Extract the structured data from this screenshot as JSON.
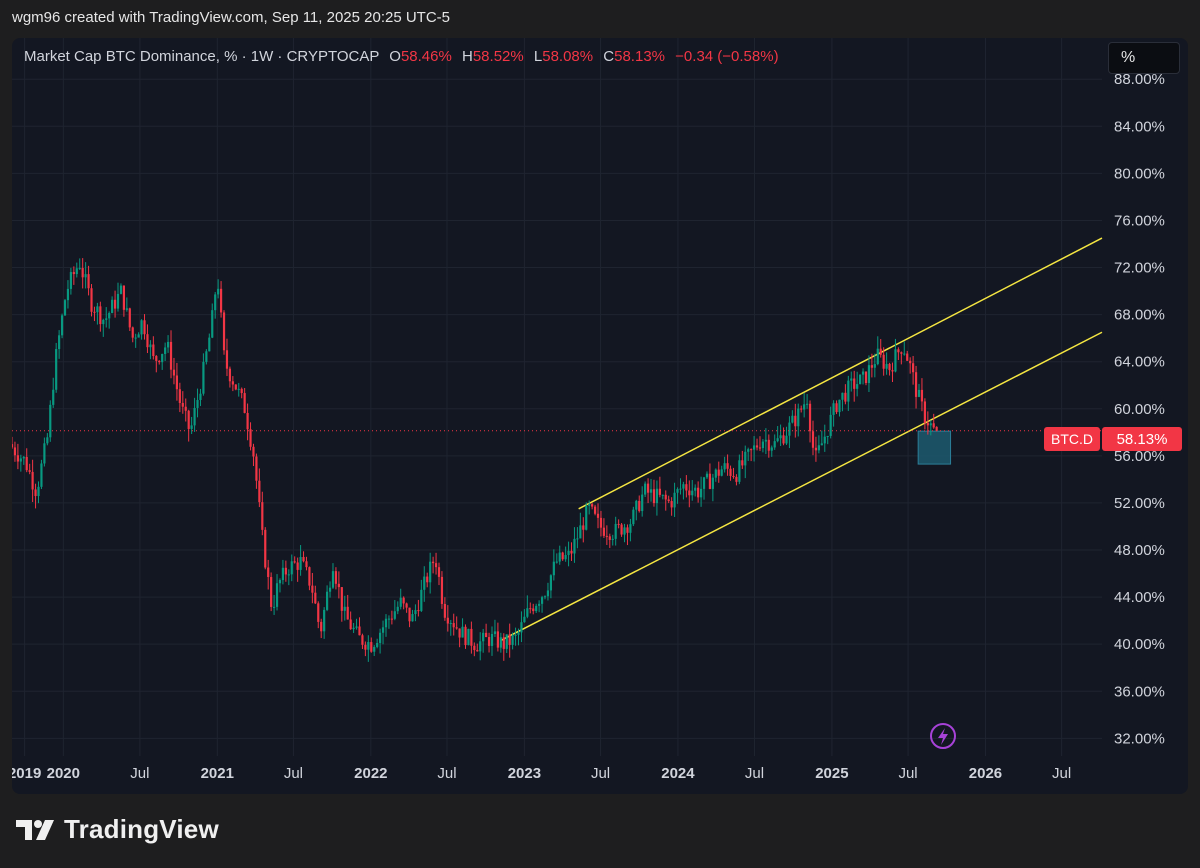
{
  "header": {
    "credit": "wgm96 created with TradingView.com, Sep 11, 2025 20:25 UTC-5"
  },
  "legend": {
    "symbol": "Market Cap BTC Dominance, % · 1W · CRYPTOCAP",
    "o_label": "O",
    "o_value": "58.46%",
    "h_label": "H",
    "h_value": "58.52%",
    "l_label": "L",
    "l_value": "58.08%",
    "c_label": "C",
    "c_value": "58.13%",
    "change": "−0.34 (−0.58%)"
  },
  "scale_button": {
    "label": "%"
  },
  "price_tag": {
    "symbol": "BTC.D",
    "value": "58.13%"
  },
  "footer": {
    "brand": "TradingView"
  },
  "colors": {
    "background": "#131722",
    "up": "#089981",
    "down": "#f23645",
    "channel": "#f5e642",
    "box": "#1d5a6e",
    "grid": "#1f2430"
  },
  "icons": {
    "flash": "lightning-bolt-icon",
    "logo": "tradingview-logo-icon"
  },
  "chart_data": {
    "type": "candlestick",
    "title": "Market Cap BTC Dominance, % · 1W · CRYPTOCAP",
    "y_unit": "%",
    "ylim": [
      30.5,
      91.5
    ],
    "xlim": [
      "2019-09-01",
      "2026-10-05"
    ],
    "y_ticks": [
      "88.00%",
      "84.00%",
      "80.00%",
      "76.00%",
      "72.00%",
      "68.00%",
      "64.00%",
      "60.00%",
      "56.00%",
      "52.00%",
      "48.00%",
      "44.00%",
      "40.00%",
      "36.00%",
      "32.00%"
    ],
    "x_ticks": [
      {
        "label": "2019",
        "date": "2019-10-01",
        "bold": true
      },
      {
        "label": "2020",
        "date": "2020-01-01",
        "bold": true
      },
      {
        "label": "Jul",
        "date": "2020-07-01",
        "bold": false
      },
      {
        "label": "2021",
        "date": "2021-01-01",
        "bold": true
      },
      {
        "label": "Jul",
        "date": "2021-07-01",
        "bold": false
      },
      {
        "label": "2022",
        "date": "2022-01-01",
        "bold": true
      },
      {
        "label": "Jul",
        "date": "2022-07-01",
        "bold": false
      },
      {
        "label": "2023",
        "date": "2023-01-01",
        "bold": true
      },
      {
        "label": "Jul",
        "date": "2023-07-01",
        "bold": false
      },
      {
        "label": "2024",
        "date": "2024-01-01",
        "bold": true
      },
      {
        "label": "Jul",
        "date": "2024-07-01",
        "bold": false
      },
      {
        "label": "2025",
        "date": "2025-01-01",
        "bold": true
      },
      {
        "label": "Jul",
        "date": "2025-07-01",
        "bold": false
      },
      {
        "label": "2026",
        "date": "2026-01-01",
        "bold": true
      },
      {
        "label": "Jul",
        "date": "2026-07-01",
        "bold": false
      }
    ],
    "price_path": [
      [
        "2019-09-01",
        57.0
      ],
      [
        "2019-10-10",
        55.5
      ],
      [
        "2019-11-05",
        53.0
      ],
      [
        "2019-12-01",
        57.5
      ],
      [
        "2019-12-20",
        64.0
      ],
      [
        "2020-01-15",
        70.0
      ],
      [
        "2020-02-15",
        72.5
      ],
      [
        "2020-03-15",
        69.0
      ],
      [
        "2020-04-15",
        67.5
      ],
      [
        "2020-05-25",
        70.0
      ],
      [
        "2020-06-20",
        66.0
      ],
      [
        "2020-07-15",
        67.5
      ],
      [
        "2020-08-10",
        64.0
      ],
      [
        "2020-09-10",
        65.5
      ],
      [
        "2020-10-15",
        60.0
      ],
      [
        "2020-11-05",
        58.0
      ],
      [
        "2020-12-05",
        63.0
      ],
      [
        "2020-12-25",
        67.0
      ],
      [
        "2021-01-08",
        71.5
      ],
      [
        "2021-01-25",
        64.0
      ],
      [
        "2021-02-20",
        62.0
      ],
      [
        "2021-03-15",
        60.0
      ],
      [
        "2021-04-05",
        56.0
      ],
      [
        "2021-04-25",
        49.0
      ],
      [
        "2021-05-18",
        43.0
      ],
      [
        "2021-06-01",
        45.0
      ],
      [
        "2021-06-25",
        46.5
      ],
      [
        "2021-07-25",
        47.0
      ],
      [
        "2021-08-20",
        45.0
      ],
      [
        "2021-09-10",
        41.0
      ],
      [
        "2021-10-10",
        47.0
      ],
      [
        "2021-11-05",
        42.5
      ],
      [
        "2021-12-10",
        40.5
      ],
      [
        "2022-01-10",
        40.0
      ],
      [
        "2022-02-15",
        42.0
      ],
      [
        "2022-03-20",
        43.5
      ],
      [
        "2022-04-15",
        42.0
      ],
      [
        "2022-05-20",
        45.5
      ],
      [
        "2022-06-10",
        47.5
      ],
      [
        "2022-07-01",
        43.0
      ],
      [
        "2022-08-10",
        41.0
      ],
      [
        "2022-09-15",
        40.0
      ],
      [
        "2022-10-20",
        40.5
      ],
      [
        "2022-11-20",
        40.0
      ],
      [
        "2022-12-20",
        40.5
      ],
      [
        "2023-01-20",
        43.0
      ],
      [
        "2023-02-25",
        44.5
      ],
      [
        "2023-03-25",
        47.0
      ],
      [
        "2023-04-25",
        47.5
      ],
      [
        "2023-06-10",
        51.5
      ],
      [
        "2023-07-05",
        50.0
      ],
      [
        "2023-08-10",
        49.5
      ],
      [
        "2023-09-20",
        50.5
      ],
      [
        "2023-10-20",
        53.0
      ],
      [
        "2023-11-20",
        52.5
      ],
      [
        "2023-12-20",
        52.0
      ],
      [
        "2024-01-20",
        53.5
      ],
      [
        "2024-02-25",
        53.0
      ],
      [
        "2024-03-25",
        54.0
      ],
      [
        "2024-04-25",
        55.0
      ],
      [
        "2024-05-25",
        54.5
      ],
      [
        "2024-06-25",
        56.0
      ],
      [
        "2024-07-25",
        57.5
      ],
      [
        "2024-08-25",
        57.0
      ],
      [
        "2024-09-20",
        58.0
      ],
      [
        "2024-10-20",
        59.5
      ],
      [
        "2024-11-10",
        61.0
      ],
      [
        "2024-11-28",
        55.5
      ],
      [
        "2024-12-20",
        57.5
      ],
      [
        "2025-01-20",
        60.5
      ],
      [
        "2025-02-25",
        62.0
      ],
      [
        "2025-03-25",
        62.5
      ],
      [
        "2025-04-25",
        64.5
      ],
      [
        "2025-05-25",
        63.5
      ],
      [
        "2025-06-25",
        65.5
      ],
      [
        "2025-07-10",
        64.0
      ],
      [
        "2025-07-28",
        61.5
      ],
      [
        "2025-08-15",
        59.5
      ],
      [
        "2025-09-01",
        58.5
      ],
      [
        "2025-09-08",
        58.1
      ]
    ],
    "last_candle": {
      "date": "2025-09-08",
      "open": 58.46,
      "high": 58.52,
      "low": 58.08,
      "close": 58.13
    },
    "price_line": 58.13,
    "channel_upper": {
      "from": [
        "2023-05-10",
        51.5
      ],
      "to": [
        "2026-10-05",
        74.5
      ]
    },
    "channel_lower": {
      "from": [
        "2022-11-05",
        40.3
      ],
      "to": [
        "2026-10-05",
        66.5
      ]
    },
    "target_box": {
      "from_date": "2025-07-25",
      "to_date": "2025-10-10",
      "low": 55.3,
      "high": 58.1
    }
  }
}
